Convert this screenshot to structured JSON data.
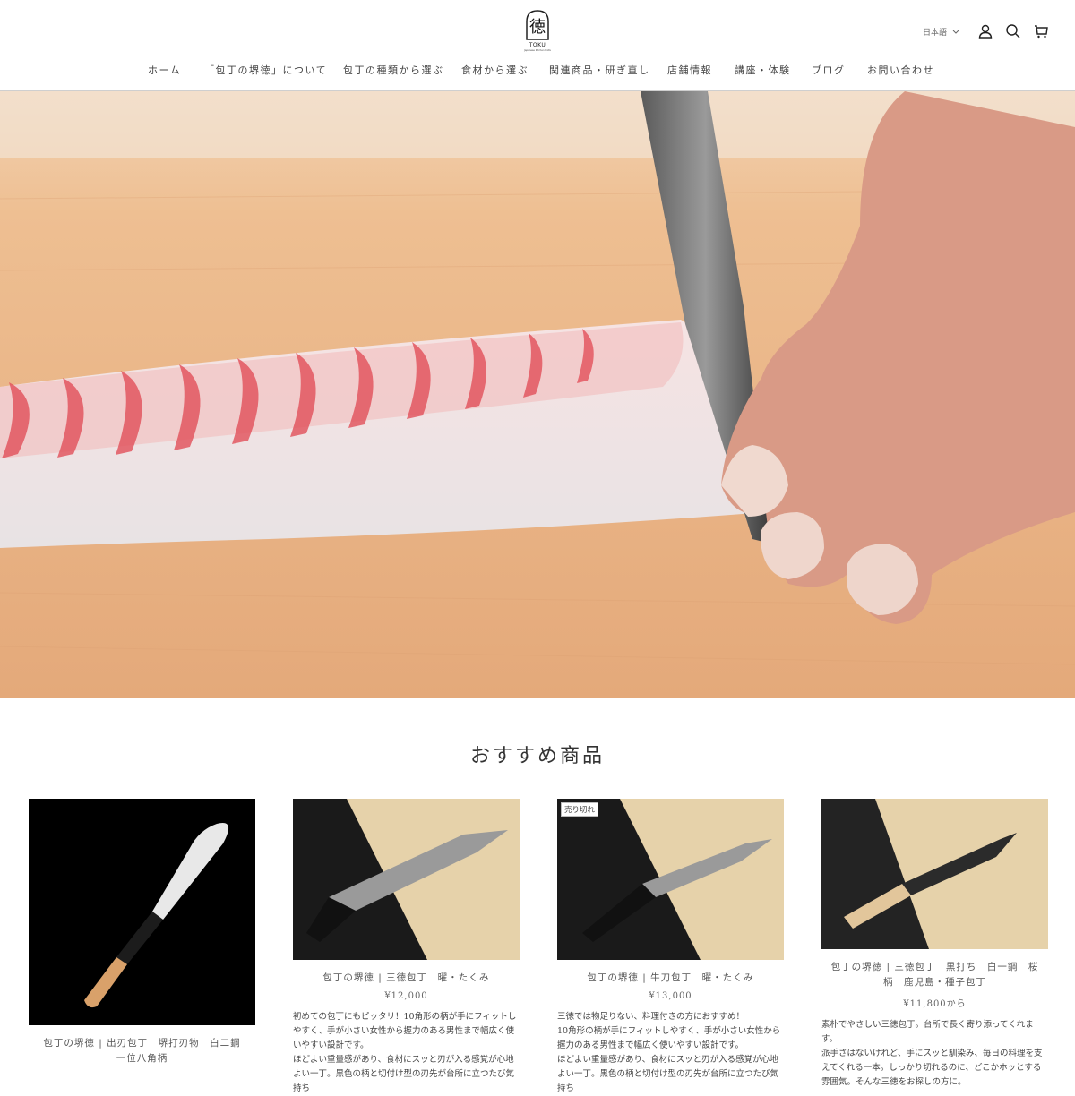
{
  "header": {
    "logo_text": "TOKU",
    "logo_sub": "Japanese Kitchen Knife",
    "language": "日本語",
    "nav": [
      {
        "label": "ホーム"
      },
      {
        "label": "「包丁の堺徳」について"
      },
      {
        "label": "包丁の種類から選ぶ"
      },
      {
        "label": "食材から選ぶ"
      },
      {
        "label": "関連商品・研ぎ直し"
      },
      {
        "label": "店舗情報"
      },
      {
        "label": "講座・体験"
      },
      {
        "label": "ブログ"
      },
      {
        "label": "お問い合わせ"
      }
    ]
  },
  "featured": {
    "title": "おすすめ商品",
    "products": [
      {
        "title": "包丁の堺徳 | 出刃包丁　堺打刃物　白二鋼　一位八角柄",
        "price": "",
        "badge": "",
        "desc": ""
      },
      {
        "title": "包丁の堺徳 | 三徳包丁　曜・たくみ",
        "price": "¥12,000",
        "badge": "",
        "desc": "初めての包丁にもピッタリ！10角形の柄が手にフィットしやすく、手が小さい女性から握力のある男性まで幅広く使いやすい設計です。\nほどよい重量感があり、食材にスッと刃が入る感覚が心地よい一丁。黒色の柄と切付け型の刃先が台所に立つたび気持ち"
      },
      {
        "title": "包丁の堺徳 | 牛刀包丁　曜・たくみ",
        "price": "¥13,000",
        "badge": "売り切れ",
        "desc": "三徳では物足りない、料理付きの方におすすめ！\n10角形の柄が手にフィットしやすく、手が小さい女性から握力のある男性まで幅広く使いやすい設計です。\nほどよい重量感があり、食材にスッと刃が入る感覚が心地よい一丁。黒色の柄と切付け型の刃先が台所に立つたび気持ち"
      },
      {
        "title": "包丁の堺徳 | 三徳包丁　黒打ち　白一鋼　桜柄　鹿児島・種子包丁",
        "price": "¥11,800から",
        "badge": "",
        "desc": "素朴でやさしい三徳包丁。台所で長く寄り添ってくれます。\n派手さはないけれど、手にスッと馴染み、毎日の料理を支えてくれる一本。しっかり切れるのに、どこかホッとする雰囲気。そんな三徳をお探しの方に。"
      }
    ]
  },
  "colors": {
    "board": "#e9b98a",
    "fish_red": "#e2505a",
    "accent": "#333333"
  }
}
